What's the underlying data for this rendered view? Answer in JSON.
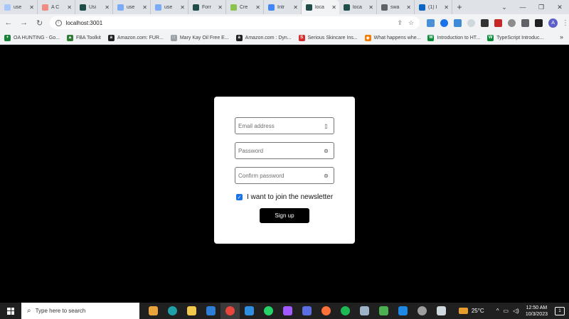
{
  "browser": {
    "tabs": [
      {
        "title": "use",
        "color": "#a8c7fa"
      },
      {
        "title": "A C",
        "color": "#f28b82"
      },
      {
        "title": "Usi",
        "color": "#1e4d4a"
      },
      {
        "title": "use",
        "color": "#7baaf7"
      },
      {
        "title": "use",
        "color": "#7baaf7"
      },
      {
        "title": "Forr",
        "color": "#1e4d4a"
      },
      {
        "title": "Cre",
        "color": "#8bc34a"
      },
      {
        "title": "Intr",
        "color": "#4285f4"
      },
      {
        "title": "loca",
        "color": "#1e4d4a"
      },
      {
        "title": "loca",
        "color": "#1e4d4a"
      },
      {
        "title": "swa",
        "color": "#5f6368"
      },
      {
        "title": "(1) I",
        "color": "#0a66c2"
      }
    ],
    "new_tab_label": "+",
    "address": "localhost:3001",
    "profile_initial": "A",
    "bookmarks": [
      {
        "label": "OA HUNTING - Go...",
        "color": "#188038",
        "glyph": "+"
      },
      {
        "label": "FBA Toolkit",
        "color": "#2e7d32",
        "glyph": "▲"
      },
      {
        "label": "Amazon.com: FUR...",
        "color": "#222",
        "glyph": "a"
      },
      {
        "label": "Mary Kay Oil Free E...",
        "color": "#9aa0a6",
        "glyph": "□"
      },
      {
        "label": "Amazon.com : Dyn...",
        "color": "#222",
        "glyph": "a"
      },
      {
        "label": "Serious Skincare Ins...",
        "color": "#d32f2f",
        "glyph": "S"
      },
      {
        "label": "What happens whe...",
        "color": "#f57c00",
        "glyph": "◆"
      },
      {
        "label": "Introduction to HT...",
        "color": "#0a8a3a",
        "glyph": "W"
      },
      {
        "label": "TypeScript Introduc...",
        "color": "#0a8a3a",
        "glyph": "W"
      }
    ]
  },
  "form": {
    "email_placeholder": "Email address",
    "password_placeholder": "Password",
    "confirm_placeholder": "Confirm password",
    "newsletter_label": "I want to join the newsletter",
    "newsletter_checked": true,
    "submit_label": "Sign up"
  },
  "taskbar": {
    "search_placeholder": "Type here to search",
    "temperature": "25°C",
    "time": "12:50 AM",
    "date": "10/3/2023",
    "notification_count": "1"
  }
}
